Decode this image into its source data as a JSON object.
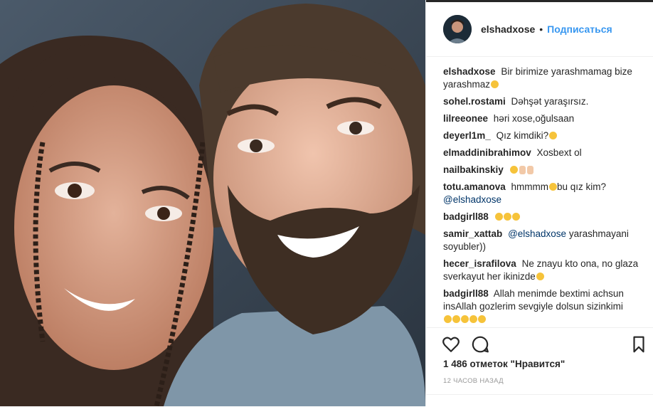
{
  "post": {
    "username": "elshadxose",
    "dot": "•",
    "follow_label": "Подписаться"
  },
  "comments": [
    {
      "user": "elshadxose",
      "text": "Bir birimize yarashmamag bize yarashmaz"
    },
    {
      "user": "sohel.rostami",
      "text": "Dəhşət yaraşırsız."
    },
    {
      "user": "lilreeonee",
      "text": "həri xose,oğulsaan"
    },
    {
      "user": "deyerl1m_",
      "text": "Qız kimdiki?"
    },
    {
      "user": "elmaddinibrahimov",
      "text": "Xosbext ol"
    },
    {
      "user": "nailbakinskiy",
      "text": ""
    },
    {
      "user": "totu.amanova",
      "text": "hmmmm",
      "text2": "bu qız kim?",
      "mention": "@elshadxose"
    },
    {
      "user": "badgirll88",
      "text": ""
    },
    {
      "user": "samir_xattab",
      "mention": "@elshadxose",
      "text": "yarashmayani soyubler))"
    },
    {
      "user": "hecer_israfilova",
      "text": "Ne znayu kto ona, no glaza sverkayut her ikinizde"
    },
    {
      "user": "badgirll88",
      "text": "Allah menimde bextimi achsun insAllah gozlerim sevgiyle dolsun sizinkimi"
    }
  ],
  "likes": "1 486 отметок \"Нравится\"",
  "time": "12 ЧАСОВ НАЗАД",
  "icons": [
    "heart-icon",
    "comment-icon",
    "bookmark-icon"
  ],
  "colors": {
    "link": "#3897f0",
    "mention": "#003569",
    "text": "#262626",
    "muted": "#999999"
  }
}
